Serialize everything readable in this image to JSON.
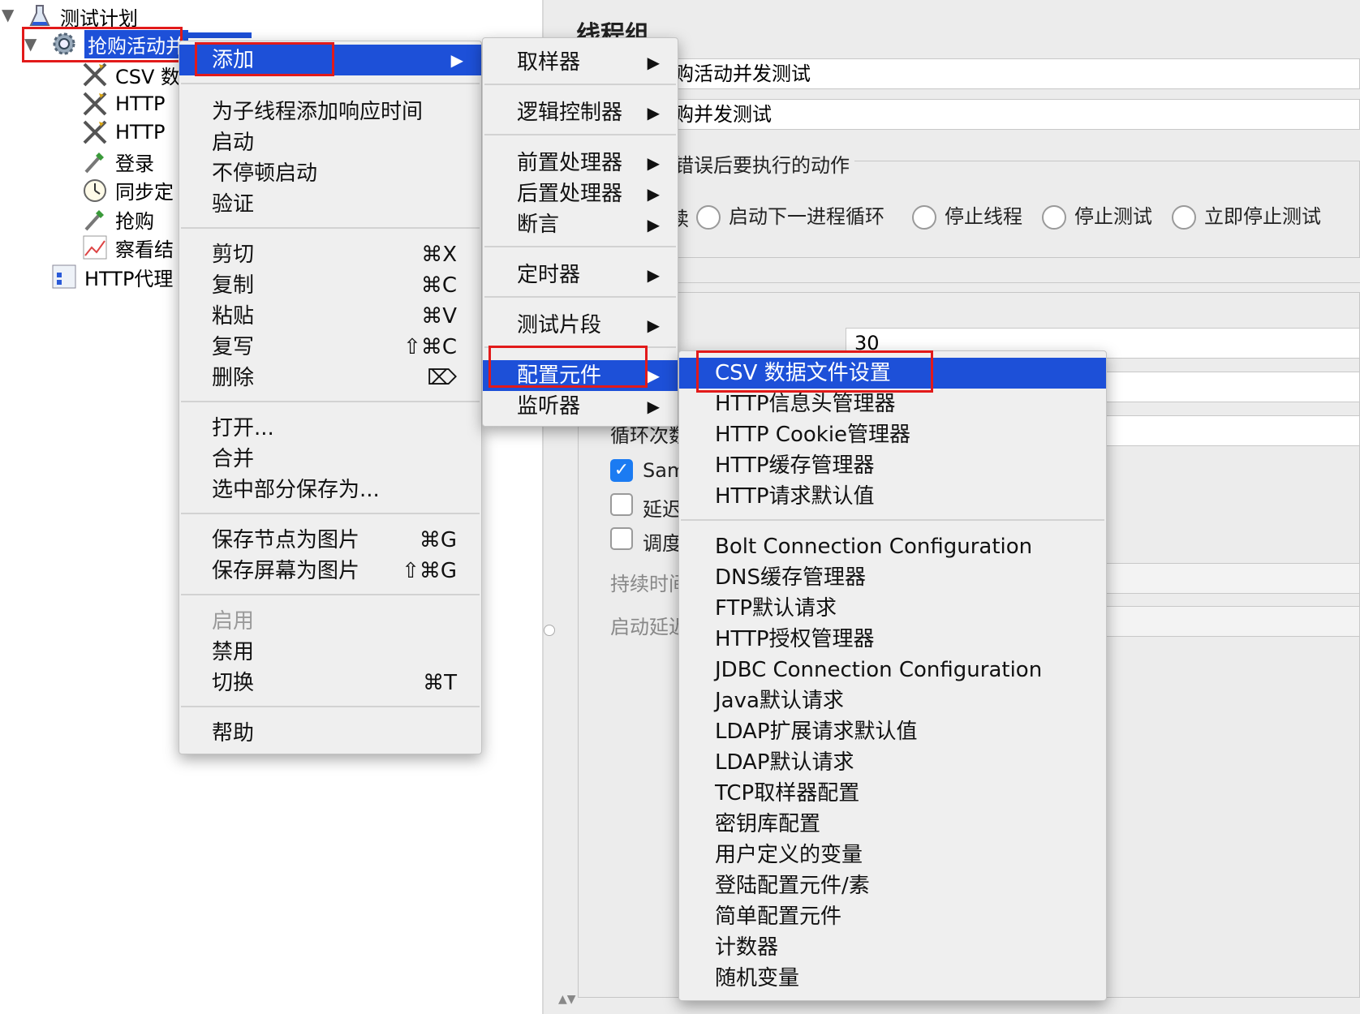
{
  "tree": {
    "items": [
      {
        "label": "测试计划",
        "icon": "flask-icon"
      },
      {
        "label": "抢购活动并",
        "icon": "gear-icon"
      },
      {
        "label": "CSV 数",
        "icon": "wrench-icon"
      },
      {
        "label": "HTTP",
        "icon": "wrench-icon"
      },
      {
        "label": "HTTP",
        "icon": "wrench-icon"
      },
      {
        "label": "登录",
        "icon": "pipette-icon"
      },
      {
        "label": "同步定",
        "icon": "timer-icon"
      },
      {
        "label": "抢购",
        "icon": "pipette-icon"
      },
      {
        "label": "察看结",
        "icon": "graph-icon"
      },
      {
        "label": "HTTP代理",
        "icon": "proxy-icon"
      }
    ]
  },
  "right_panel": {
    "title": "线程组",
    "name_value": "购活动并发测试",
    "comment_value": "购并发测试",
    "error_action_legend": "错误后要执行的动作",
    "error_options": [
      "续",
      "启动下一进程循环",
      "停止线程",
      "停止测试",
      "立即停止测试"
    ],
    "threads_value": "30",
    "loop_label": "循环次数",
    "same_user_label": "Sam",
    "delay_label": "延迟",
    "scheduler_label": "调度",
    "duration_label": "持续时间",
    "startup_delay_label": "启动延迟"
  },
  "menu1": {
    "items": [
      {
        "label": "添加",
        "shortcut": "",
        "submenu": true,
        "active": true
      },
      {
        "label": "为子线程添加响应时间",
        "shortcut": ""
      },
      {
        "label": "启动",
        "shortcut": ""
      },
      {
        "label": "不停顿启动",
        "shortcut": ""
      },
      {
        "label": "验证",
        "shortcut": ""
      },
      {
        "label": "剪切",
        "shortcut": "⌘X"
      },
      {
        "label": "复制",
        "shortcut": "⌘C"
      },
      {
        "label": "粘贴",
        "shortcut": "⌘V"
      },
      {
        "label": "复写",
        "shortcut": "⇧⌘C"
      },
      {
        "label": "删除",
        "shortcut": "⌦"
      },
      {
        "label": "打开...",
        "shortcut": ""
      },
      {
        "label": "合并",
        "shortcut": ""
      },
      {
        "label": "选中部分保存为...",
        "shortcut": ""
      },
      {
        "label": "保存节点为图片",
        "shortcut": "⌘G"
      },
      {
        "label": "保存屏幕为图片",
        "shortcut": "⇧⌘G"
      },
      {
        "label": "启用",
        "shortcut": "",
        "disabled": true
      },
      {
        "label": "禁用",
        "shortcut": ""
      },
      {
        "label": "切换",
        "shortcut": "⌘T"
      },
      {
        "label": "帮助",
        "shortcut": ""
      }
    ]
  },
  "menu2": {
    "items": [
      {
        "label": "取样器"
      },
      {
        "label": "逻辑控制器"
      },
      {
        "label": "前置处理器"
      },
      {
        "label": "后置处理器"
      },
      {
        "label": "断言"
      },
      {
        "label": "定时器"
      },
      {
        "label": "测试片段"
      },
      {
        "label": "配置元件",
        "active": true
      },
      {
        "label": "监听器"
      }
    ],
    "arrow": "▶"
  },
  "menu3": {
    "items": [
      {
        "label": "CSV 数据文件设置",
        "active": true
      },
      {
        "label": "HTTP信息头管理器"
      },
      {
        "label": "HTTP Cookie管理器"
      },
      {
        "label": "HTTP缓存管理器"
      },
      {
        "label": "HTTP请求默认值"
      },
      {
        "label": "Bolt Connection Configuration"
      },
      {
        "label": "DNS缓存管理器"
      },
      {
        "label": "FTP默认请求"
      },
      {
        "label": "HTTP授权管理器"
      },
      {
        "label": "JDBC Connection Configuration"
      },
      {
        "label": "Java默认请求"
      },
      {
        "label": "LDAP扩展请求默认值"
      },
      {
        "label": "LDAP默认请求"
      },
      {
        "label": "TCP取样器配置"
      },
      {
        "label": "密钥库配置"
      },
      {
        "label": "用户定义的变量"
      },
      {
        "label": "登陆配置元件/素"
      },
      {
        "label": "简单配置元件"
      },
      {
        "label": "计数器"
      },
      {
        "label": "随机变量"
      }
    ]
  },
  "colors": {
    "selection": "#1d50d8",
    "highlight_box": "#e21a1a",
    "checkbox": "#1b7bf2"
  }
}
